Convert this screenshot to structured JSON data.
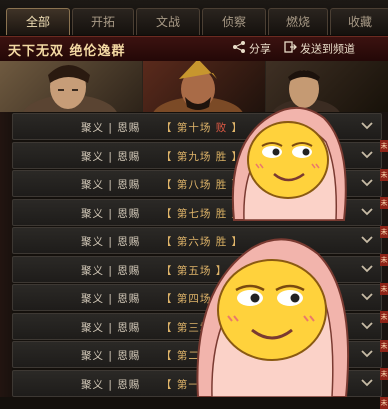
{
  "tabs": [
    {
      "label": "全部",
      "active": true
    },
    {
      "label": "开拓",
      "active": false
    },
    {
      "label": "文战",
      "active": false
    },
    {
      "label": "侦察",
      "active": false
    },
    {
      "label": "燃烧",
      "active": false
    },
    {
      "label": "收藏",
      "active": false
    }
  ],
  "header": {
    "title": "天下无双  绝伦逸群",
    "share_label": "分享",
    "send_label": "发送到频道"
  },
  "portraits": [
    {
      "icon": "general-portrait-icon"
    },
    {
      "icon": "warrior-portrait-icon"
    },
    {
      "icon": "strategist-portrait-icon"
    }
  ],
  "rows": [
    {
      "name": "聚义 | 恩赐",
      "battle": "第十场",
      "result": "败",
      "lose": true
    },
    {
      "name": "聚义 | 恩赐",
      "battle": "第九场",
      "result": "胜",
      "lose": false
    },
    {
      "name": "聚义 | 恩赐",
      "battle": "第八场",
      "result": "胜",
      "lose": false
    },
    {
      "name": "聚义 | 恩赐",
      "battle": "第七场",
      "result": "胜",
      "lose": false
    },
    {
      "name": "聚义 | 恩赐",
      "battle": "第六场",
      "result": "胜",
      "lose": false
    },
    {
      "name": "聚义 | 恩赐",
      "battle": "第五场",
      "result": "",
      "lose": false
    },
    {
      "name": "聚义 | 恩赐",
      "battle": "第四场",
      "result": "",
      "lose": false
    },
    {
      "name": "聚义 | 恩赐",
      "battle": "第三场",
      "result": "",
      "lose": false
    },
    {
      "name": "聚义 | 恩赐",
      "battle": "第二场",
      "result": "",
      "lose": false
    },
    {
      "name": "聚义 | 恩赐",
      "battle": "第一场",
      "result": "",
      "lose": false
    }
  ],
  "edge_tag": "未",
  "colors": {
    "accent_gold": "#e0b56a",
    "lose_red": "#e05a45",
    "header_red": "#3b1210"
  }
}
